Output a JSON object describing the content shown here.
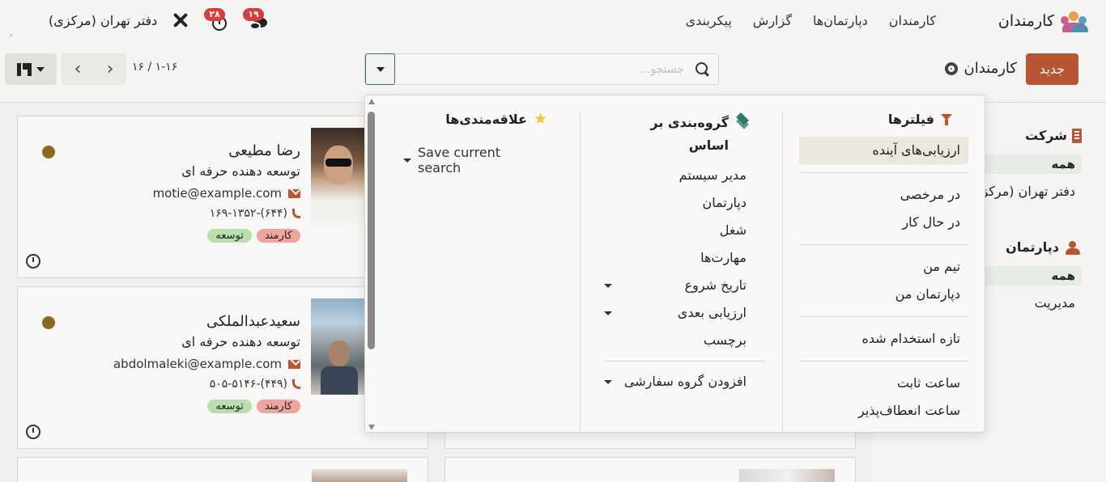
{
  "nav": {
    "app_name": "کارمندان",
    "menu": [
      "کارمندان",
      "دپارتمان‌ها",
      "گزارش",
      "پیکربندی"
    ],
    "company": "دفتر تهران (مرکزی)",
    "activity_count": "۲۸",
    "message_count": "۱۹"
  },
  "control": {
    "new_label": "جدید",
    "title": "کارمندان",
    "search_placeholder": "جستجو...",
    "pager": "۱-۱۶ / ۱۶"
  },
  "side_panel": {
    "company_title": "شرکت",
    "company_all": "همه",
    "company_item": "دفتر تهران (مرکزی)",
    "department_title": "دپارتمان",
    "department_all": "همه",
    "department_item": "مدیریت"
  },
  "employees": [
    {
      "name": "رضا مطیعی",
      "job": "توسعه دهنده حرفه ای",
      "email": "motie@example.com",
      "phone": "(۶۴۴)-۱۶۹-۱۳۵۲",
      "tags": [
        "کارمند",
        "توسعه"
      ]
    },
    {
      "name": "سعیدعبدالملکی",
      "job": "توسعه دهنده حرفه ای",
      "email": "abdolmaleki@example.com",
      "phone": "(۴۴۹)-۵۰۵-۵۱۴۶",
      "tags": [
        "کارمند",
        "توسعه"
      ]
    }
  ],
  "dropdown": {
    "filters_title": "فیلترها",
    "filters": {
      "group1": [
        "ارزیابی‌های آینده"
      ],
      "group2": [
        "در مرخصی",
        "در حال کار"
      ],
      "group3": [
        "تیم من",
        "دپارتمان من"
      ],
      "group4": [
        "تازه استخدام شده"
      ],
      "group5": [
        "ساعت ثابت",
        "ساعت انعطاف‌پذیر"
      ]
    },
    "groupby_title": "گروه‌بندی بر اساس",
    "groupby": [
      "مدیر سیستم",
      "دپارتمان",
      "شغل",
      "مهارت‌ها",
      "تاریخ شروع",
      "ارزیابی بعدی",
      "برچسب"
    ],
    "custom_group": "افزودن گروه سفارشی",
    "favorites_title": "علاقه‌مندی‌ها",
    "save_search": "Save current search"
  },
  "colors": {
    "primary": "#b75634",
    "tag_red": "#efa59d",
    "tag_green": "#b9dfae",
    "status_dot": "#8a6a20",
    "groupby_icon": "#2f7a6a",
    "star": "#f2c33c"
  },
  "icons": [
    "app-logo",
    "tools-icon",
    "clock-icon",
    "chat-icon",
    "gear-icon",
    "search-icon",
    "caret-down-icon",
    "kanban-icon",
    "building-icon",
    "users-icon",
    "envelope-icon",
    "phone-icon",
    "funnel-icon",
    "layers-icon",
    "star-icon"
  ]
}
